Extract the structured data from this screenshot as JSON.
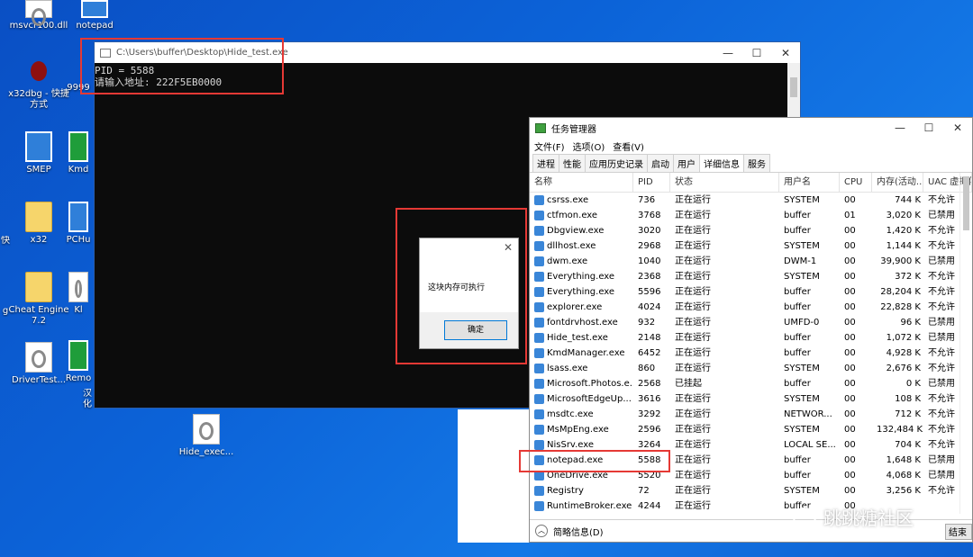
{
  "desktop": {
    "icons": [
      {
        "label": "msvcr100.dll"
      },
      {
        "label": "notepad"
      },
      {
        "label": "x32dbg - 快捷方式"
      },
      {
        "label": "9999"
      },
      {
        "label": "SMEP"
      },
      {
        "label": "Kmd"
      },
      {
        "label": "x32"
      },
      {
        "label": "PCHu"
      },
      {
        "label": "Cheat Engine 7.2"
      },
      {
        "label": "Kl"
      },
      {
        "label": "DriverTest..."
      },
      {
        "label": "Remo"
      },
      {
        "label": "Hide_exec..."
      },
      {
        "label": "快"
      },
      {
        "label": "g"
      },
      {
        "label": "汉化"
      }
    ]
  },
  "console": {
    "title": "C:\\Users\\buffer\\Desktop\\Hide_test.exe",
    "lines": [
      "PID = 5588",
      "请输入地址: 222F5EB0000"
    ]
  },
  "msgbox": {
    "message": "这块内存可执行",
    "ok_label": "确定"
  },
  "taskmgr": {
    "title": "任务管理器",
    "menu": [
      "文件(F)",
      "选项(O)",
      "查看(V)"
    ],
    "tabs": [
      "进程",
      "性能",
      "应用历史记录",
      "启动",
      "用户",
      "详细信息",
      "服务"
    ],
    "active_tab": "详细信息",
    "columns": [
      "名称",
      "PID",
      "状态",
      "用户名",
      "CPU",
      "内存(活动...",
      "UAC 虚拟化"
    ],
    "rows": [
      [
        "csrss.exe",
        "736",
        "正在运行",
        "SYSTEM",
        "00",
        "744 K",
        "不允许"
      ],
      [
        "ctfmon.exe",
        "3768",
        "正在运行",
        "buffer",
        "01",
        "3,020 K",
        "已禁用"
      ],
      [
        "Dbgview.exe",
        "3020",
        "正在运行",
        "buffer",
        "00",
        "1,420 K",
        "不允许"
      ],
      [
        "dllhost.exe",
        "2968",
        "正在运行",
        "SYSTEM",
        "00",
        "1,144 K",
        "不允许"
      ],
      [
        "dwm.exe",
        "1040",
        "正在运行",
        "DWM-1",
        "00",
        "39,900 K",
        "已禁用"
      ],
      [
        "Everything.exe",
        "2368",
        "正在运行",
        "SYSTEM",
        "00",
        "372 K",
        "不允许"
      ],
      [
        "Everything.exe",
        "5596",
        "正在运行",
        "buffer",
        "00",
        "28,204 K",
        "不允许"
      ],
      [
        "explorer.exe",
        "4024",
        "正在运行",
        "buffer",
        "00",
        "22,828 K",
        "不允许"
      ],
      [
        "fontdrvhost.exe",
        "932",
        "正在运行",
        "UMFD-0",
        "00",
        "96 K",
        "已禁用"
      ],
      [
        "Hide_test.exe",
        "2148",
        "正在运行",
        "buffer",
        "00",
        "1,072 K",
        "已禁用"
      ],
      [
        "KmdManager.exe",
        "6452",
        "正在运行",
        "buffer",
        "00",
        "4,928 K",
        "不允许"
      ],
      [
        "lsass.exe",
        "860",
        "正在运行",
        "SYSTEM",
        "00",
        "2,676 K",
        "不允许"
      ],
      [
        "Microsoft.Photos.e...",
        "2568",
        "已挂起",
        "buffer",
        "00",
        "0 K",
        "已禁用"
      ],
      [
        "MicrosoftEdgeUp...",
        "3616",
        "正在运行",
        "SYSTEM",
        "00",
        "108 K",
        "不允许"
      ],
      [
        "msdtc.exe",
        "3292",
        "正在运行",
        "NETWOR...",
        "00",
        "712 K",
        "不允许"
      ],
      [
        "MsMpEng.exe",
        "2596",
        "正在运行",
        "SYSTEM",
        "00",
        "132,484 K",
        "不允许"
      ],
      [
        "NisSrv.exe",
        "3264",
        "正在运行",
        "LOCAL SE...",
        "00",
        "704 K",
        "不允许"
      ],
      [
        "notepad.exe",
        "5588",
        "正在运行",
        "buffer",
        "00",
        "1,648 K",
        "已禁用"
      ],
      [
        "OneDrive.exe",
        "5520",
        "正在运行",
        "buffer",
        "00",
        "4,068 K",
        "已禁用"
      ],
      [
        "Registry",
        "72",
        "正在运行",
        "SYSTEM",
        "00",
        "3,256 K",
        "不允许"
      ],
      [
        "RuntimeBroker.exe",
        "4244",
        "正在运行",
        "buffer",
        "00",
        "",
        ""
      ]
    ],
    "footer_label": "简略信息(D)",
    "end_task_label": "结束"
  },
  "watermark": "跳跳糖社区"
}
